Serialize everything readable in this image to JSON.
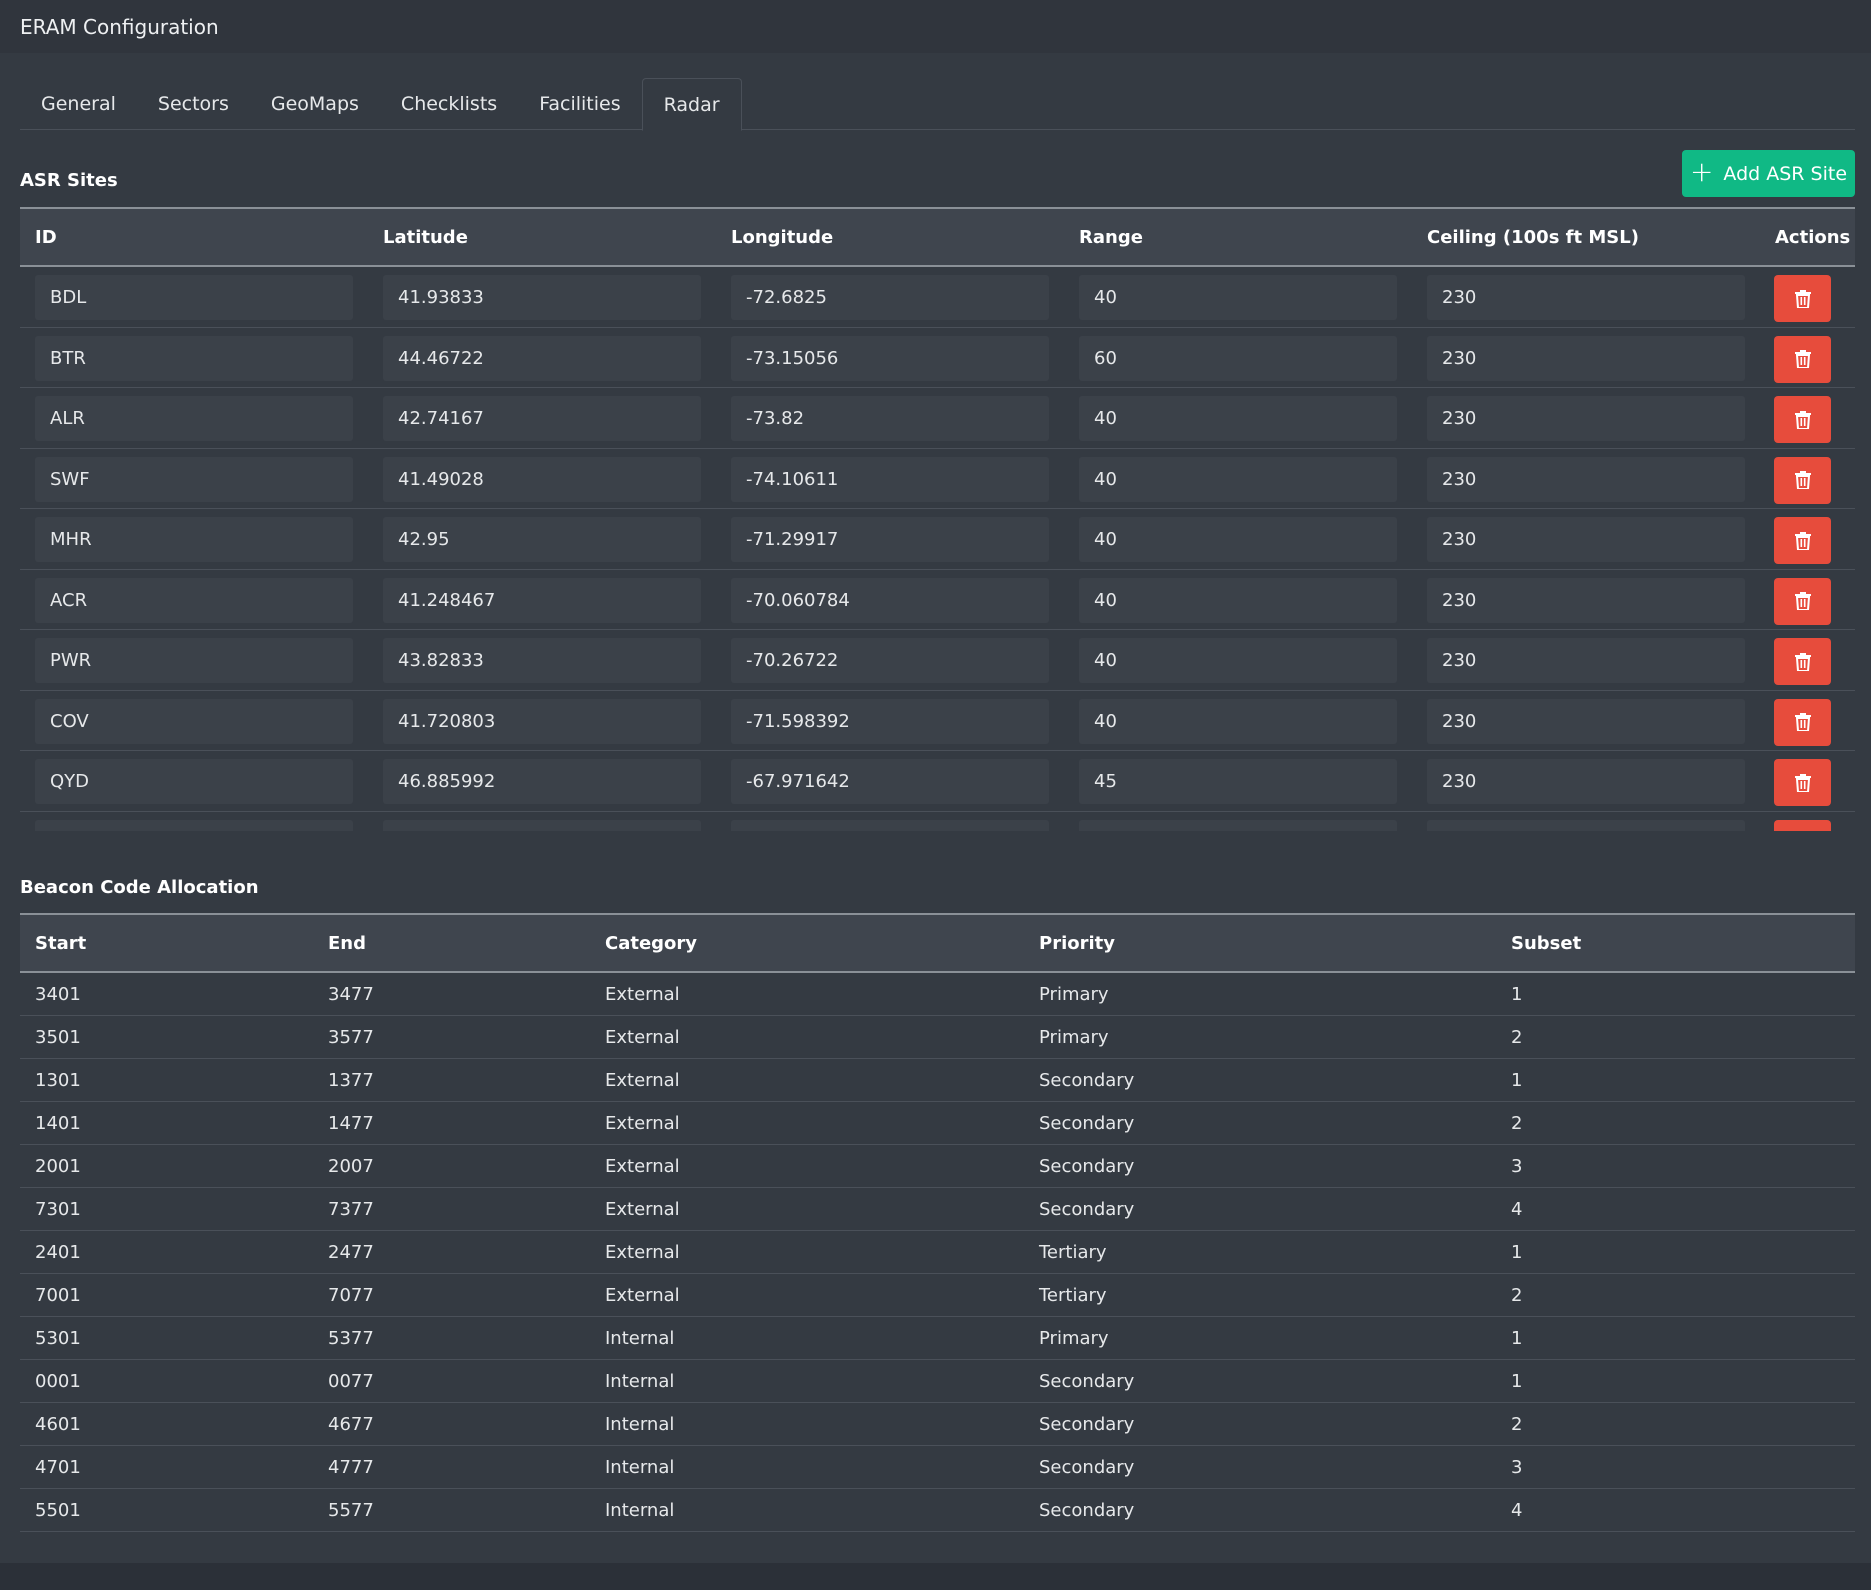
{
  "app": {
    "title": "ERAM Configuration"
  },
  "tabs": [
    {
      "label": "General"
    },
    {
      "label": "Sectors"
    },
    {
      "label": "GeoMaps"
    },
    {
      "label": "Checklists"
    },
    {
      "label": "Facilities"
    },
    {
      "label": "Radar",
      "active": true
    }
  ],
  "asr": {
    "title": "ASR Sites",
    "add_label": "Add ASR Site",
    "columns": [
      "ID",
      "Latitude",
      "Longitude",
      "Range",
      "Ceiling (100s ft MSL)",
      "Actions"
    ],
    "rows": [
      {
        "id": "BDL",
        "lat": "41.93833",
        "lon": "-72.6825",
        "range": "40",
        "ceiling": "230"
      },
      {
        "id": "BTR",
        "lat": "44.46722",
        "lon": "-73.15056",
        "range": "60",
        "ceiling": "230"
      },
      {
        "id": "ALR",
        "lat": "42.74167",
        "lon": "-73.82",
        "range": "40",
        "ceiling": "230"
      },
      {
        "id": "SWF",
        "lat": "41.49028",
        "lon": "-74.10611",
        "range": "40",
        "ceiling": "230"
      },
      {
        "id": "MHR",
        "lat": "42.95",
        "lon": "-71.29917",
        "range": "40",
        "ceiling": "230"
      },
      {
        "id": "ACR",
        "lat": "41.248467",
        "lon": "-70.060784",
        "range": "40",
        "ceiling": "230"
      },
      {
        "id": "PWR",
        "lat": "43.82833",
        "lon": "-70.26722",
        "range": "40",
        "ceiling": "230"
      },
      {
        "id": "COV",
        "lat": "41.720803",
        "lon": "-71.598392",
        "range": "40",
        "ceiling": "230"
      },
      {
        "id": "QYD",
        "lat": "46.885992",
        "lon": "-67.971642",
        "range": "45",
        "ceiling": "230"
      },
      {
        "id": "",
        "lat": "",
        "lon": "",
        "range": "",
        "ceiling": ""
      }
    ],
    "delete_icon": "trash-icon",
    "delete_color": "#e74c3c",
    "add_color": "#10b985"
  },
  "beacon": {
    "title": "Beacon Code Allocation",
    "columns": [
      "Start",
      "End",
      "Category",
      "Priority",
      "Subset"
    ],
    "rows": [
      {
        "start": "3401",
        "end": "3477",
        "category": "External",
        "priority": "Primary",
        "subset": "1"
      },
      {
        "start": "3501",
        "end": "3577",
        "category": "External",
        "priority": "Primary",
        "subset": "2"
      },
      {
        "start": "1301",
        "end": "1377",
        "category": "External",
        "priority": "Secondary",
        "subset": "1"
      },
      {
        "start": "1401",
        "end": "1477",
        "category": "External",
        "priority": "Secondary",
        "subset": "2"
      },
      {
        "start": "2001",
        "end": "2007",
        "category": "External",
        "priority": "Secondary",
        "subset": "3"
      },
      {
        "start": "7301",
        "end": "7377",
        "category": "External",
        "priority": "Secondary",
        "subset": "4"
      },
      {
        "start": "2401",
        "end": "2477",
        "category": "External",
        "priority": "Tertiary",
        "subset": "1"
      },
      {
        "start": "7001",
        "end": "7077",
        "category": "External",
        "priority": "Tertiary",
        "subset": "2"
      },
      {
        "start": "5301",
        "end": "5377",
        "category": "Internal",
        "priority": "Primary",
        "subset": "1"
      },
      {
        "start": "0001",
        "end": "0077",
        "category": "Internal",
        "priority": "Secondary",
        "subset": "1"
      },
      {
        "start": "4601",
        "end": "4677",
        "category": "Internal",
        "priority": "Secondary",
        "subset": "2"
      },
      {
        "start": "4701",
        "end": "4777",
        "category": "Internal",
        "priority": "Secondary",
        "subset": "3"
      },
      {
        "start": "5501",
        "end": "5577",
        "category": "Internal",
        "priority": "Secondary",
        "subset": "4"
      }
    ]
  }
}
